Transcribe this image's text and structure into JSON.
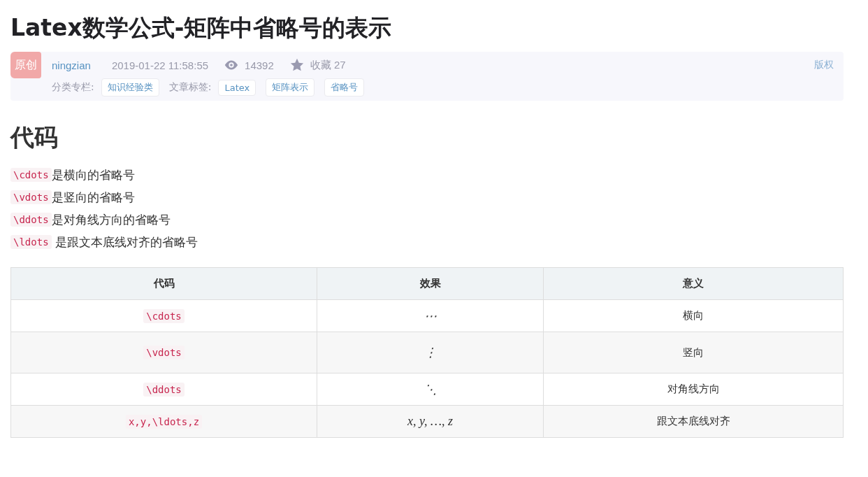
{
  "title": "Latex数学公式-矩阵中省略号的表示",
  "meta": {
    "badge": "原创",
    "author": "ningzian",
    "date": "2019-01-22 11:58:55",
    "views": "14392",
    "favorites": "收藏 27",
    "copyright": "版权",
    "category_label": "分类专栏:",
    "categories": [
      "知识经验类"
    ],
    "tags_label": "文章标签:",
    "tags": [
      "Latex",
      "矩阵表示",
      "省略号"
    ]
  },
  "heading": "代码",
  "lines": [
    {
      "code": "\\cdots",
      "text": "是横向的省略号"
    },
    {
      "code": "\\vdots",
      "text": "是竖向的省略号"
    },
    {
      "code": "\\ddots",
      "text": "是对角线方向的省略号"
    },
    {
      "code": "\\ldots",
      "text": " 是跟文本底线对齐的省略号"
    }
  ],
  "table": {
    "columns": [
      "代码",
      "效果",
      "意义"
    ],
    "rows": [
      {
        "code": "\\cdots",
        "effect": "⋯",
        "meaning": "横向"
      },
      {
        "code": "\\vdots",
        "effect": "⋮",
        "meaning": "竖向"
      },
      {
        "code": "\\ddots",
        "effect": "⋱",
        "meaning": "对角线方向"
      },
      {
        "code": "x,y,\\ldots,z",
        "effect": "x, y, …, z",
        "meaning": "跟文本底线对齐"
      }
    ]
  }
}
